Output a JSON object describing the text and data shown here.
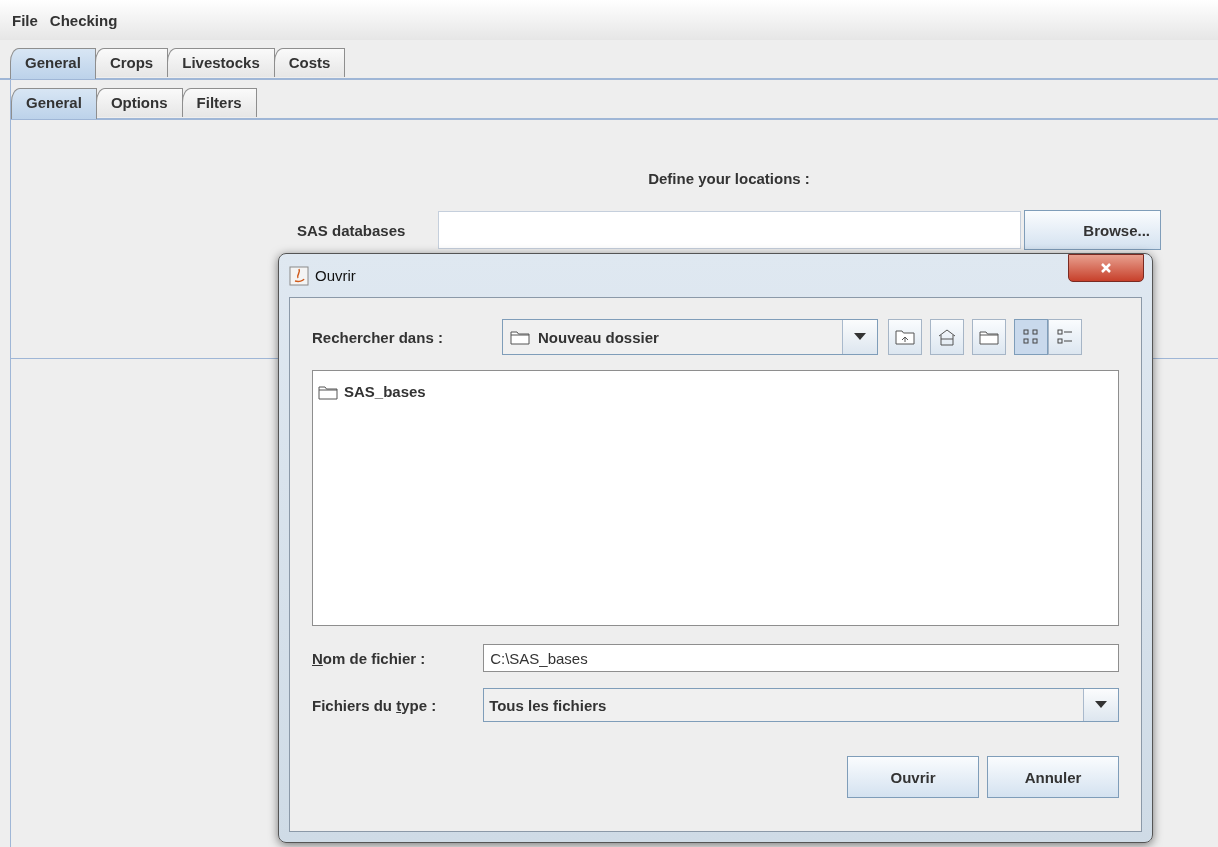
{
  "menu": [
    {
      "label": "File"
    },
    {
      "label": "Checking"
    }
  ],
  "tabs": [
    {
      "label": "General",
      "selected": true
    },
    {
      "label": "Crops",
      "selected": false
    },
    {
      "label": "Livestocks",
      "selected": false
    },
    {
      "label": "Costs",
      "selected": false
    }
  ],
  "subtabs": [
    {
      "label": "General",
      "selected": true
    },
    {
      "label": "Options",
      "selected": false
    },
    {
      "label": "Filters",
      "selected": false
    }
  ],
  "panel": {
    "heading": "Define your locations :",
    "field_label": "SAS databases",
    "button": "Browse..."
  },
  "dialog": {
    "title": "Ouvrir",
    "look_in": {
      "label": "Rechercher dans :",
      "value": "Nouveau dossier"
    },
    "views": [
      {
        "kind": "list",
        "selected": true
      },
      {
        "kind": "details",
        "selected": false
      }
    ],
    "files": [
      {
        "name": "SAS_bases"
      }
    ],
    "file_name": {
      "label": {
        "key": "N",
        "after": "om de fichier :"
      },
      "value": "C:\\SAS_bases"
    },
    "file_type": {
      "label": {
        "before": "Fichiers du ",
        "key": "t",
        "after": "ype :"
      },
      "value": "Tous les fichiers"
    },
    "buttons": [
      "Ouvrir",
      "Annuler"
    ]
  }
}
